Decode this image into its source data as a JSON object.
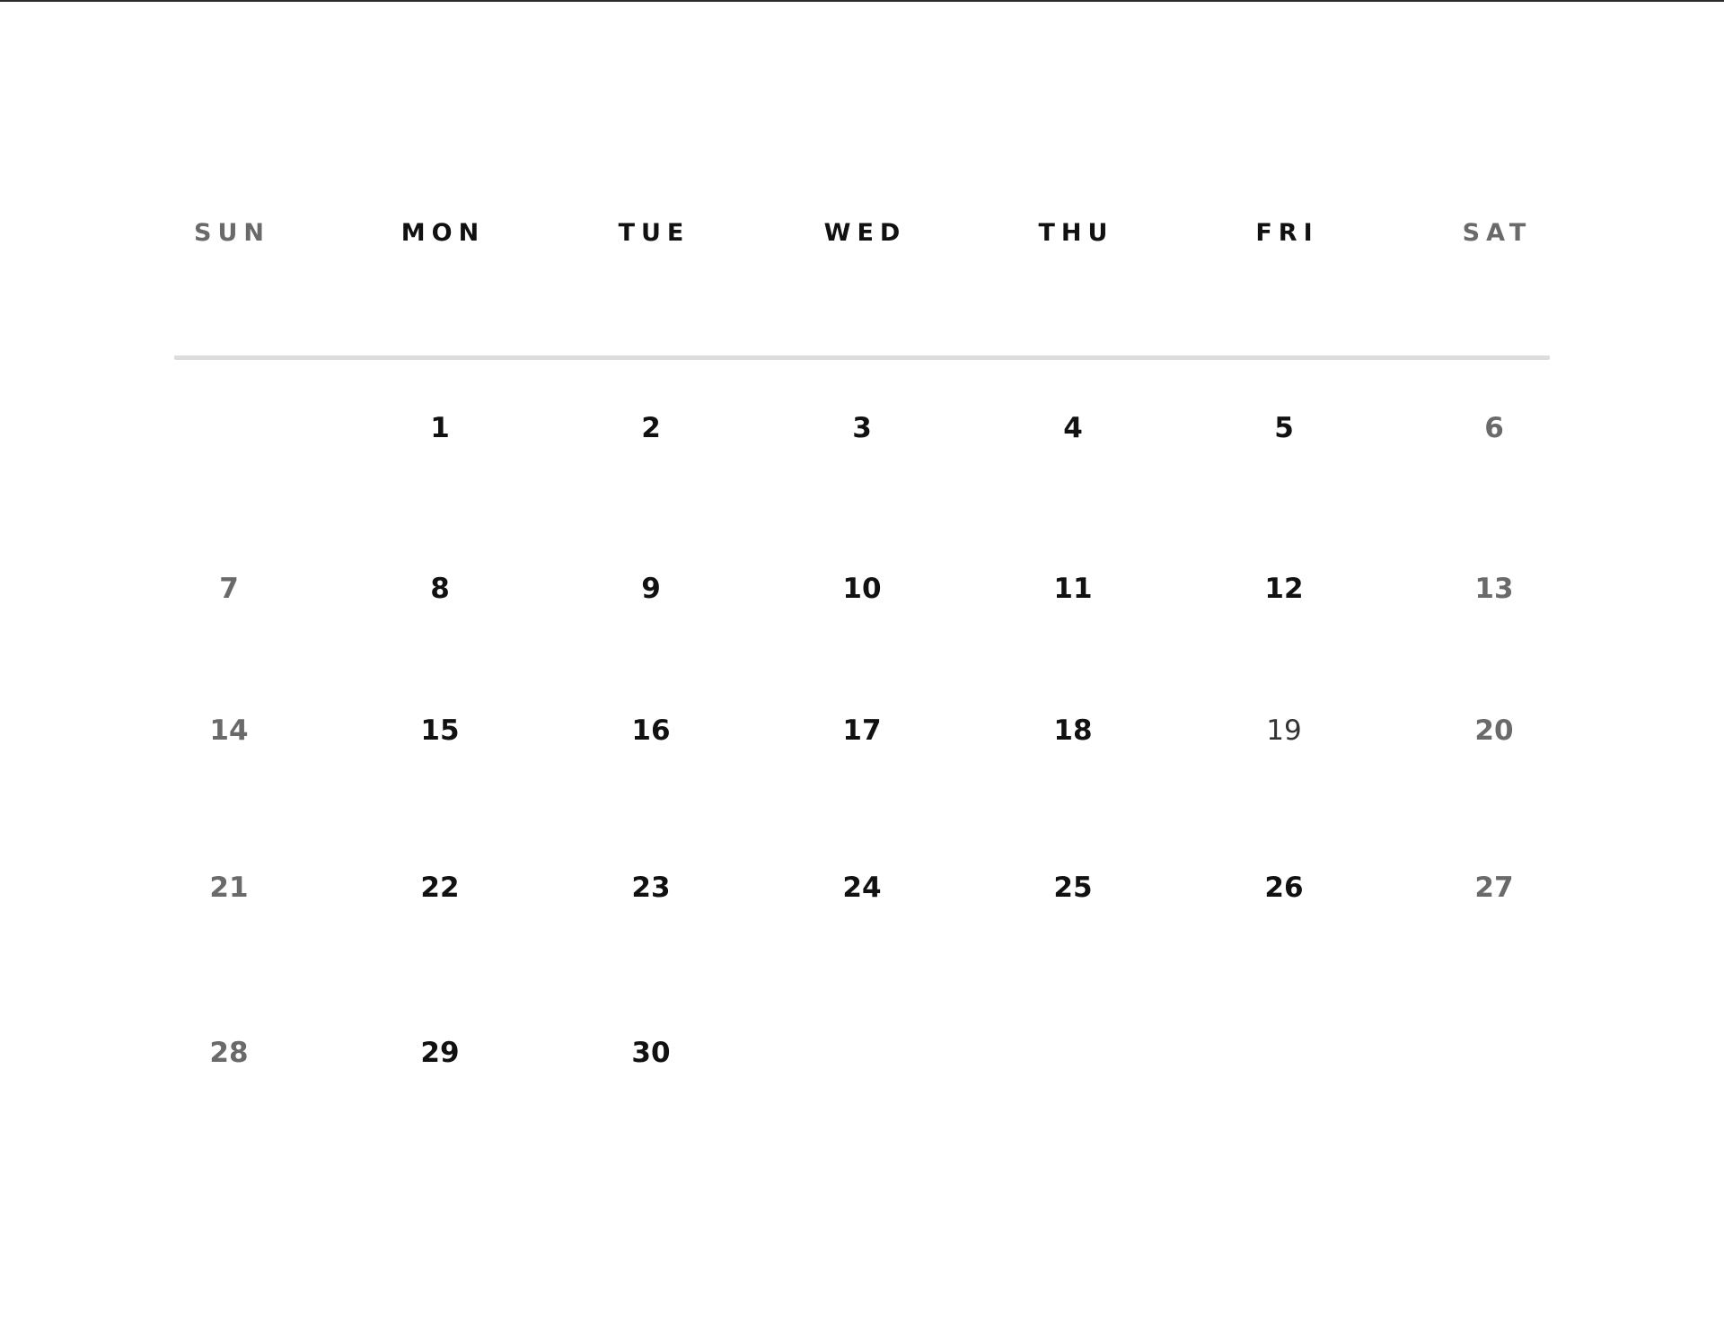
{
  "weekdays": [
    "SUN",
    "MON",
    "TUE",
    "WED",
    "THU",
    "FRI",
    "SAT"
  ],
  "weeks": [
    [
      "",
      "1",
      "2",
      "3",
      "4",
      "5",
      "6"
    ],
    [
      "7",
      "8",
      "9",
      "10",
      "11",
      "12",
      "13"
    ],
    [
      "14",
      "15",
      "16",
      "17",
      "18",
      "19",
      "20"
    ],
    [
      "21",
      "22",
      "23",
      "24",
      "25",
      "26",
      "27"
    ],
    [
      "28",
      "29",
      "30",
      "",
      "",
      "",
      ""
    ]
  ],
  "colors": {
    "weekday_text": "#111111",
    "weekend_text": "#6a6a6a",
    "divider": "#dcdcdc",
    "top_rule": "#2b2b2b",
    "background": "#ffffff"
  }
}
